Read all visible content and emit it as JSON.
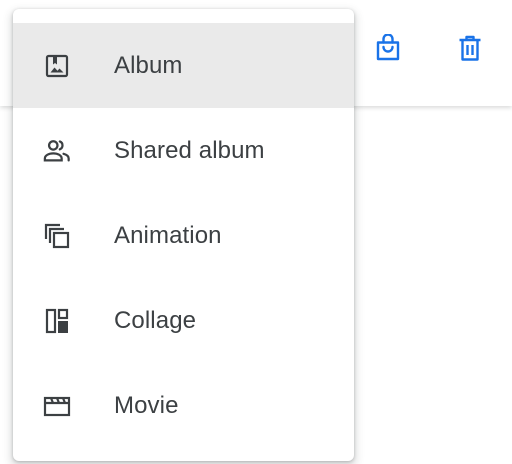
{
  "colors": {
    "accent": "#1a73e8",
    "icon_gray": "#3c4043",
    "active_bg": "#eaeaea"
  },
  "toolbar": {
    "icons": [
      "shopping-bag-icon",
      "trash-icon"
    ]
  },
  "menu": {
    "items": [
      {
        "label": "Album",
        "icon": "album-icon",
        "active": true
      },
      {
        "label": "Shared album",
        "icon": "shared-album-icon",
        "active": false
      },
      {
        "label": "Animation",
        "icon": "animation-icon",
        "active": false
      },
      {
        "label": "Collage",
        "icon": "collage-icon",
        "active": false
      },
      {
        "label": "Movie",
        "icon": "movie-icon",
        "active": false
      }
    ]
  }
}
